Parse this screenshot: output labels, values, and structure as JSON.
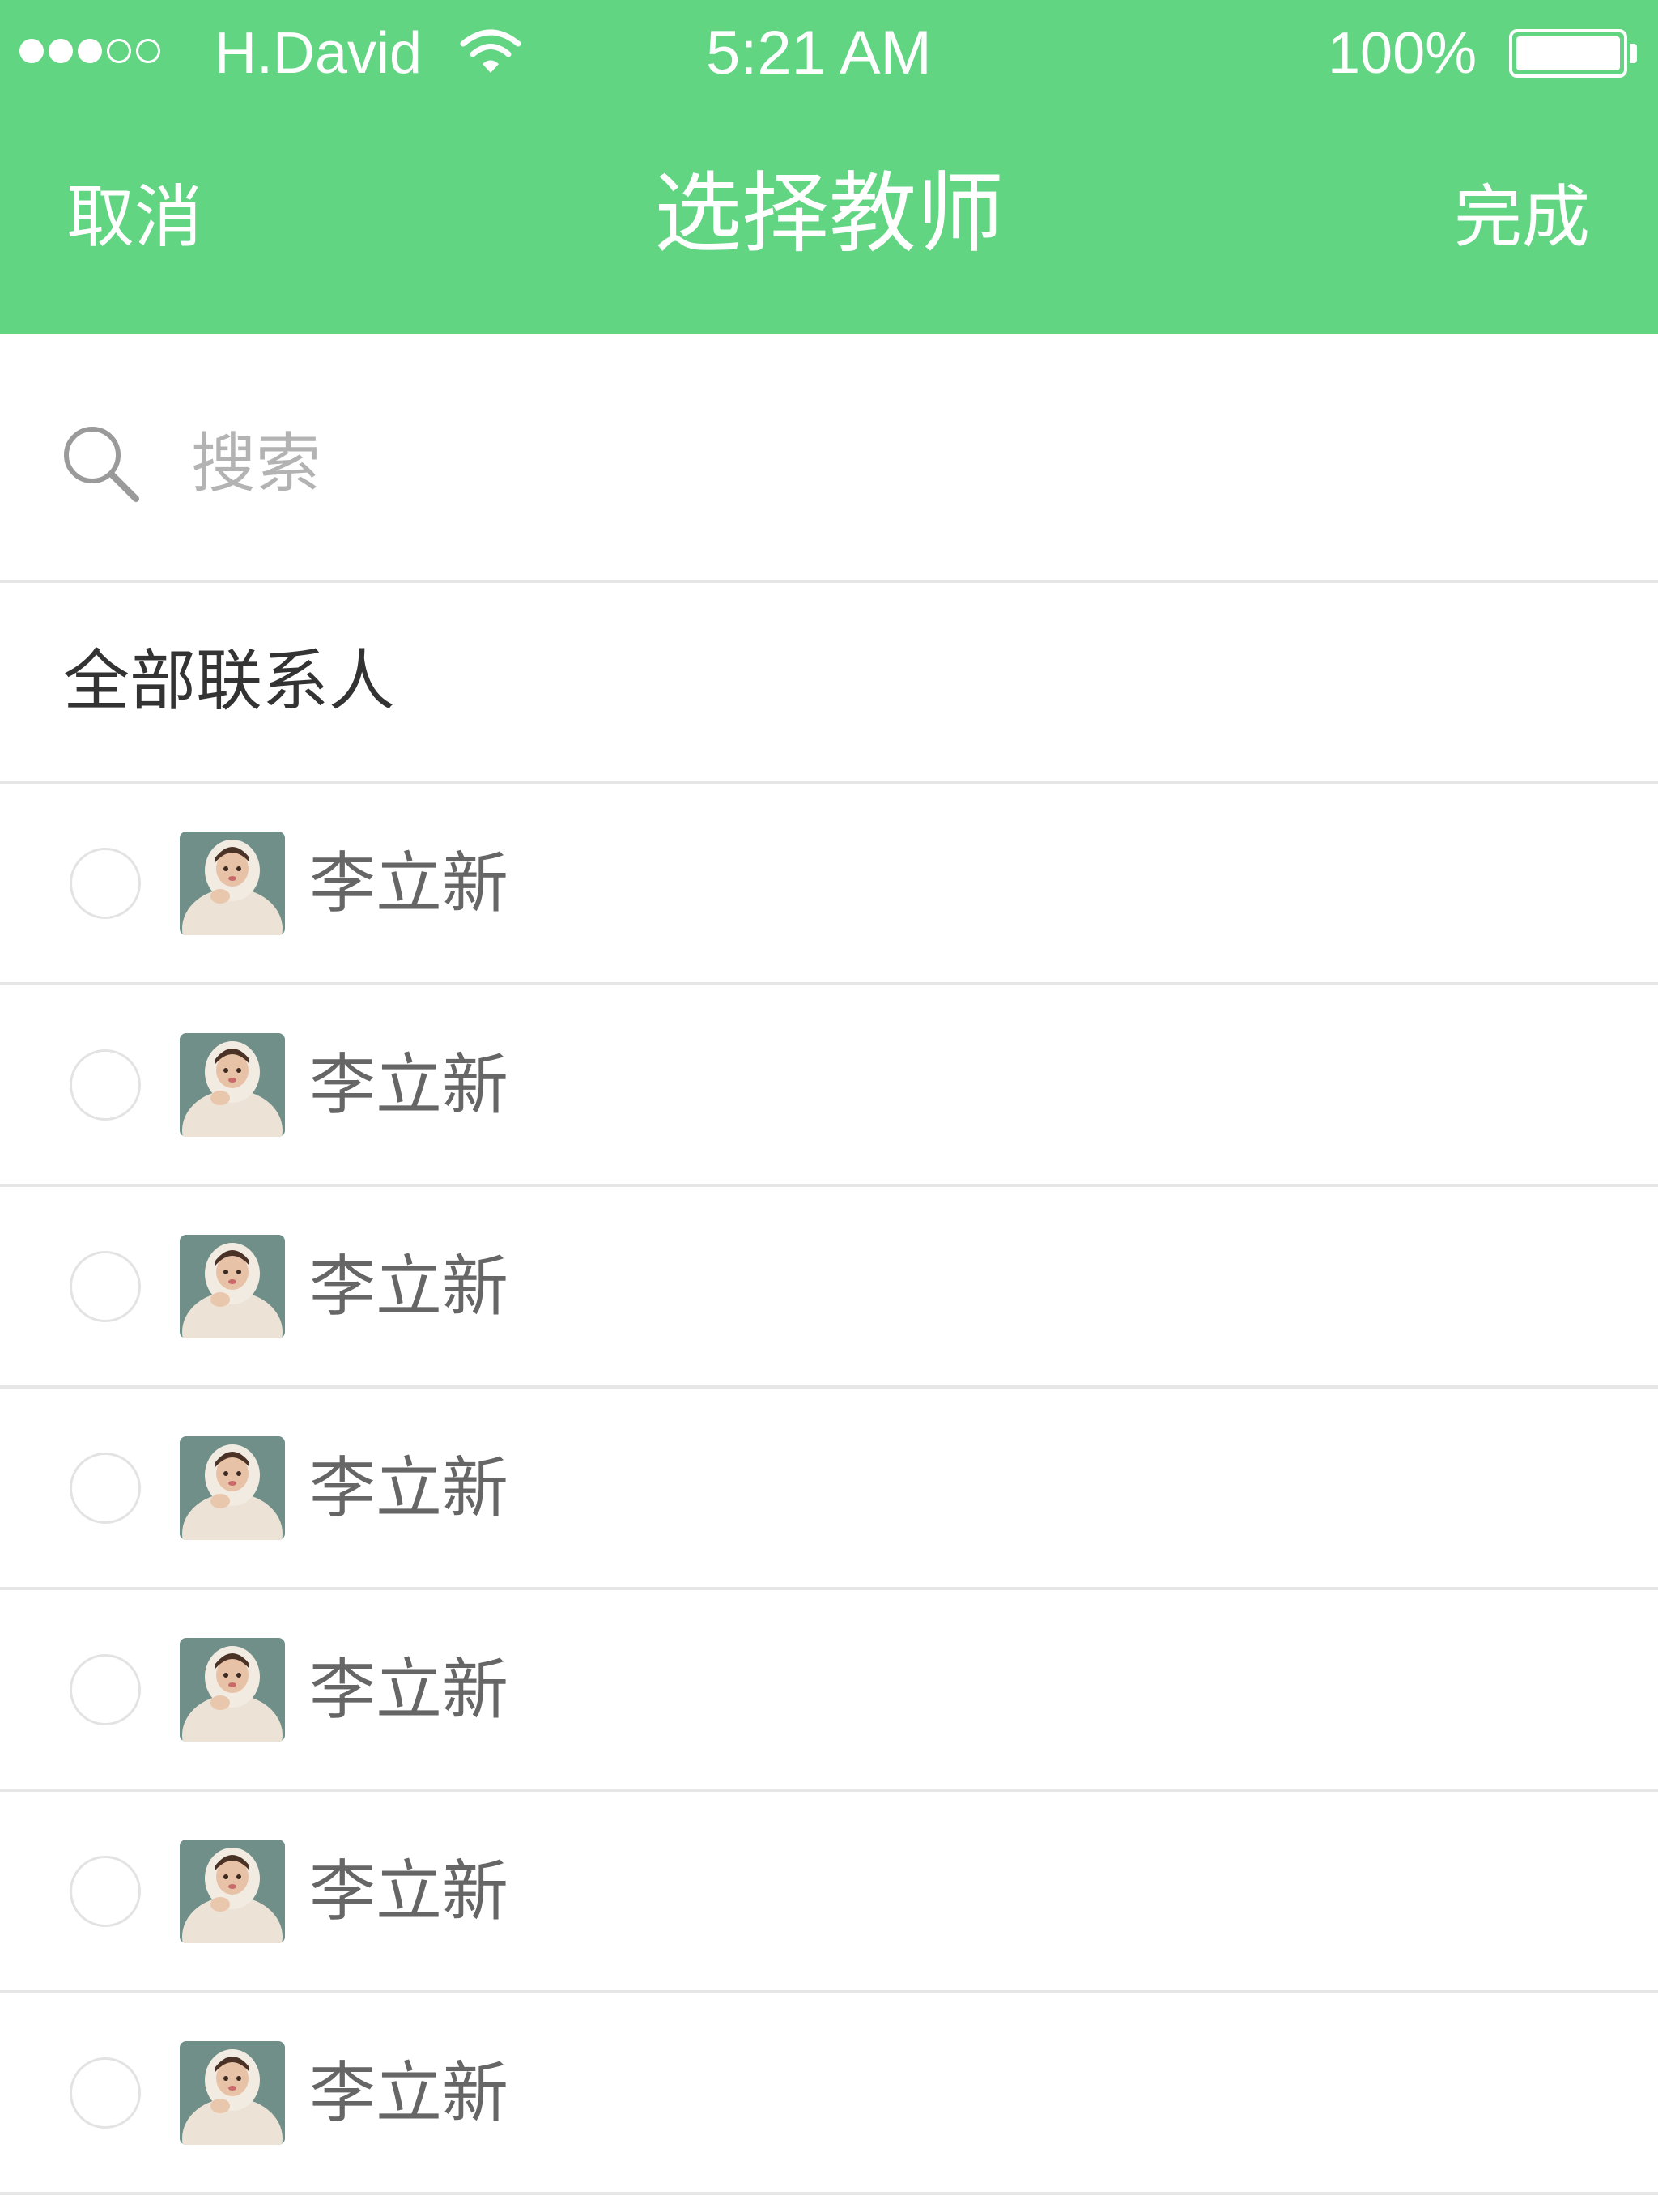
{
  "status_bar": {
    "carrier": "H.David",
    "time": "5:21 AM",
    "battery_percent": "100%",
    "signal_bars_filled": 3,
    "signal_bars_total": 5,
    "battery_level": 1.0,
    "icons": [
      "signal-icon",
      "wifi-icon",
      "battery-icon"
    ]
  },
  "navbar": {
    "cancel_label": "取消",
    "title": "选择教师",
    "done_label": "完成",
    "background_color": "#62d582"
  },
  "search": {
    "placeholder": "搜索",
    "value": "",
    "icon": "search-icon"
  },
  "section": {
    "label": "全部联系人"
  },
  "contacts": [
    {
      "name": "李立新",
      "selected": false
    },
    {
      "name": "李立新",
      "selected": false
    },
    {
      "name": "李立新",
      "selected": false
    },
    {
      "name": "李立新",
      "selected": false
    },
    {
      "name": "李立新",
      "selected": false
    },
    {
      "name": "李立新",
      "selected": false
    },
    {
      "name": "李立新",
      "selected": false
    }
  ]
}
